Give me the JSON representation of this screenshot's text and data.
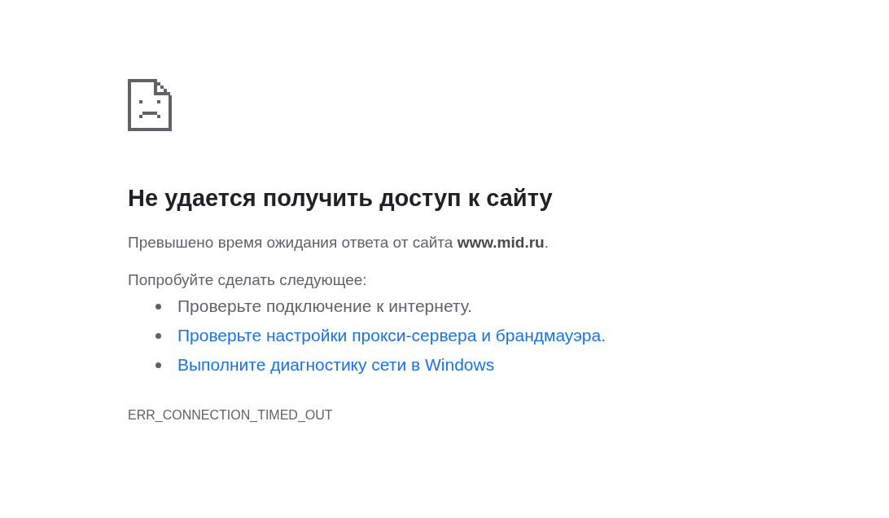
{
  "title": "Не удается получить доступ к сайту",
  "message": "Превышено время ожидания ответа от сайта **www.mid.ru**.",
  "suggestions_heading": "Попробуйте сделать следующее:",
  "suggestions": [
    {
      "kind": "text",
      "text": "Проверьте подключение к интернету."
    },
    {
      "kind": "link",
      "text": "Проверьте настройки прокси-сервера и брандмауэра."
    },
    {
      "kind": "link",
      "text": "Выполните диагностику сети в Windows"
    }
  ],
  "error_code": "ERR_CONNECTION_TIMED_OUT"
}
